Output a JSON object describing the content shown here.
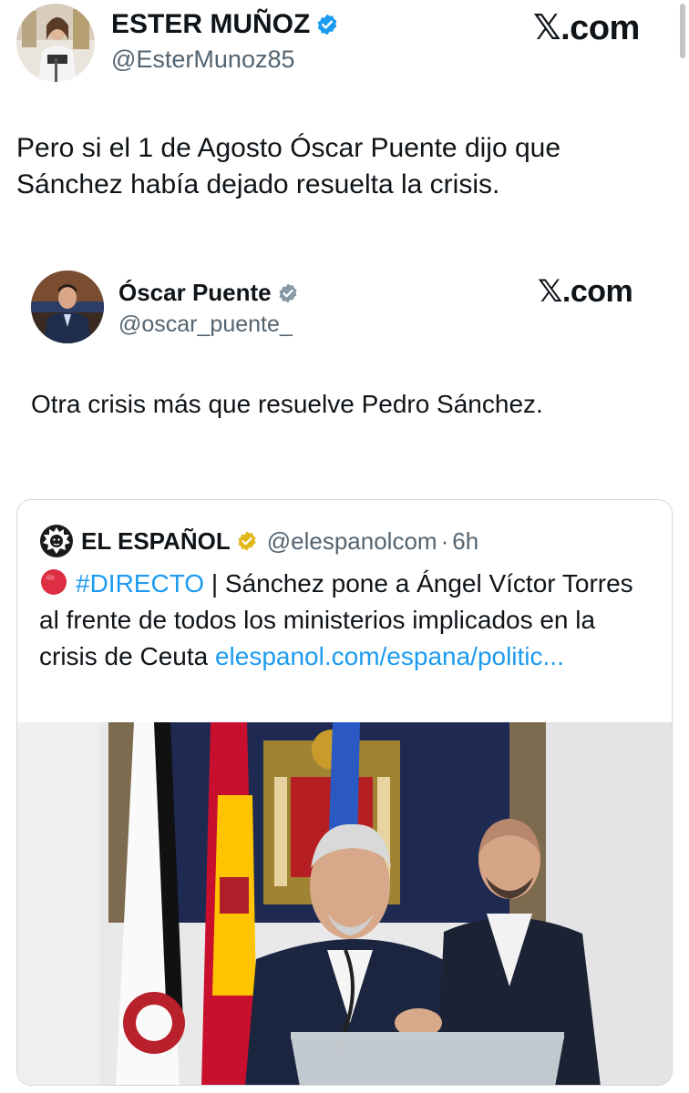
{
  "main_tweet": {
    "author_name": "ESTER MUÑOZ",
    "author_handle": "@EsterMunoz85",
    "site_label_x": "𝕏",
    "site_label_rest": ".com",
    "text": "Pero si el 1 de Agosto Óscar Puente dijo que\nSánchez había dejado resuelta la crisis."
  },
  "embedded_tweet": {
    "author_name": "Óscar Puente",
    "author_handle": "@oscar_puente_",
    "site_label_x": "𝕏",
    "site_label_rest": ".com",
    "text": "Otra crisis más que resuelve Pedro Sánchez."
  },
  "quoted_tweet": {
    "author_name": "EL ESPAÑOL",
    "author_handle": "@elespanolcom",
    "separator": "·",
    "time": "6h",
    "hashtag": "#DIRECTO",
    "text": " | Sánchez pone a Ángel Víctor Torres al frente de todos los ministerios implicados en la crisis de Ceuta ",
    "link": "elespanol.com/espana/politic..."
  },
  "colors": {
    "link": "#1d9bf0",
    "verified_blue": "#1d9bf0",
    "verified_gold": "#e2b719",
    "red_circle": "#dd2e44",
    "text": "#0f1419",
    "muted": "#536471"
  },
  "icons": [
    "verified-badge-icon",
    "red-circle-icon",
    "lion-logo-icon"
  ]
}
